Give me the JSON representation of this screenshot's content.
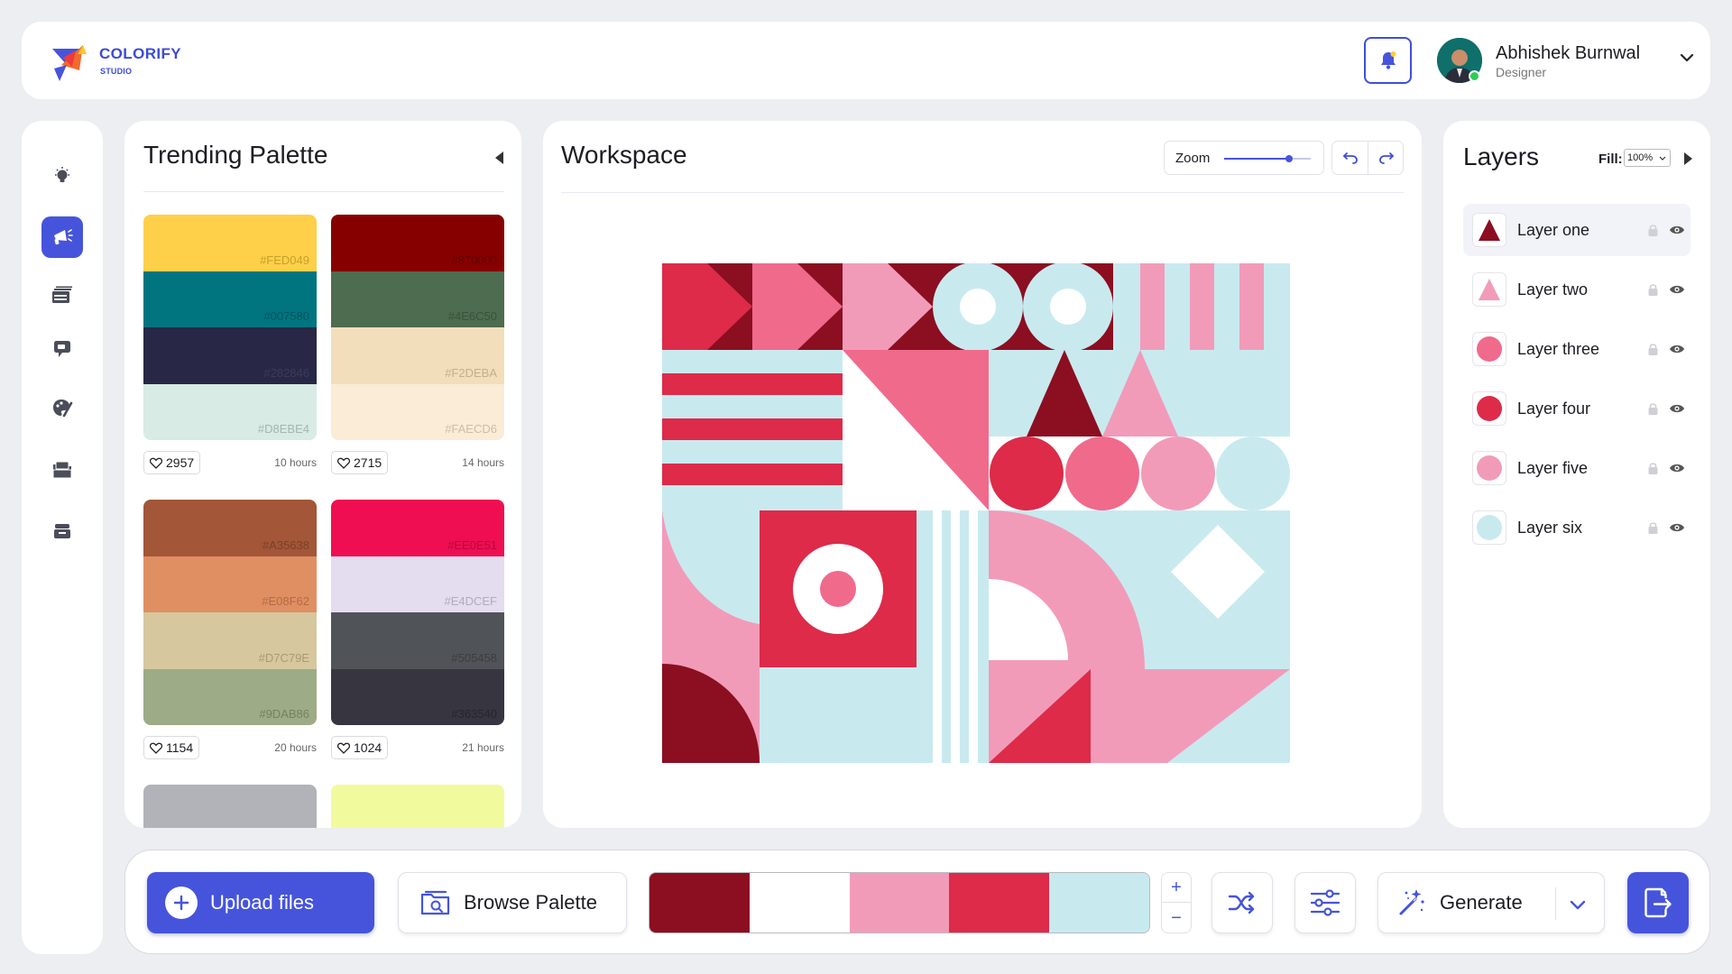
{
  "app": {
    "brand_name": "COLORIFY",
    "brand_sub": "STUDIO"
  },
  "user": {
    "name": "Abhishek Burnwal",
    "role": "Designer",
    "online": true
  },
  "sidebar": {
    "items": [
      {
        "icon": "lightbulb-icon",
        "active": false
      },
      {
        "icon": "megaphone-icon",
        "active": true
      },
      {
        "icon": "stack-icon",
        "active": false
      },
      {
        "icon": "chat-icon",
        "active": false
      },
      {
        "icon": "palette-brush-icon",
        "active": false
      },
      {
        "icon": "folder-icon",
        "active": false
      },
      {
        "icon": "archive-icon",
        "active": false
      }
    ]
  },
  "trending": {
    "title": "Trending Palette",
    "palettes": [
      {
        "likes": "2957",
        "time": "10 hours",
        "colors": [
          "#FED049",
          "#007580",
          "#282846",
          "#D8EBE4"
        ]
      },
      {
        "likes": "2715",
        "time": "14 hours",
        "colors": [
          "#870000",
          "#4E6C50",
          "#F2DEBA",
          "#FAECD6"
        ]
      },
      {
        "likes": "1154",
        "time": "20 hours",
        "colors": [
          "#A35638",
          "#E08F62",
          "#D7C79E",
          "#9DAB86"
        ]
      },
      {
        "likes": "1024",
        "time": "21 hours",
        "colors": [
          "#EE0E51",
          "#E4DCEF",
          "#505458",
          "#363540"
        ]
      },
      {
        "likes": "",
        "time": "",
        "colors": [
          "#B2B3B8"
        ]
      },
      {
        "likes": "",
        "time": "",
        "colors": [
          "#F2FA9E"
        ]
      }
    ]
  },
  "workspace": {
    "title": "Workspace",
    "zoom_label": "Zoom",
    "zoom_level": 0.75
  },
  "layers": {
    "title": "Layers",
    "fill_label": "Fill:",
    "fill_value": "100%",
    "items": [
      {
        "name": "Layer one",
        "shape": "triangle",
        "color": "#8C0E21",
        "selected": true
      },
      {
        "name": "Layer two",
        "shape": "triangle",
        "color": "#F29BB9",
        "selected": false
      },
      {
        "name": "Layer three",
        "shape": "circle",
        "color": "#F06A8C",
        "selected": false
      },
      {
        "name": "Layer four",
        "shape": "circle",
        "color": "#DD2B49",
        "selected": false
      },
      {
        "name": "Layer five",
        "shape": "circle",
        "color": "#F29BB9",
        "selected": false
      },
      {
        "name": "Layer six",
        "shape": "circle",
        "color": "#C8EAEF",
        "selected": false
      }
    ]
  },
  "toolbar": {
    "upload_label": "Upload files",
    "browse_label": "Browse Palette",
    "generate_label": "Generate",
    "palette": [
      "#8C0E21",
      "#FFFFFF",
      "#F29BB9",
      "#DD2B49",
      "#C8EAEF"
    ],
    "plus_label": "+",
    "minus_label": "−"
  },
  "colors": {
    "accent": "#4654DC",
    "background": "#ECEEF1"
  }
}
